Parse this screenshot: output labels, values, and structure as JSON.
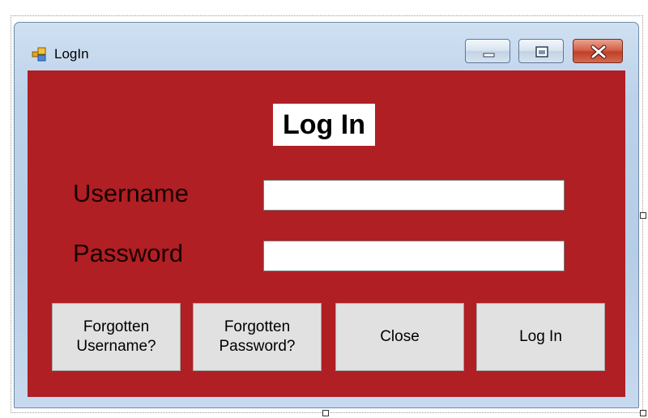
{
  "window": {
    "title": "LogIn",
    "icons": {
      "app": "form-icon",
      "minimize": "minimize-icon",
      "maximize": "maximize-icon",
      "close": "close-icon"
    }
  },
  "form": {
    "heading": "Log In",
    "username_label": "Username",
    "password_label": "Password",
    "username_value": "",
    "password_value": ""
  },
  "buttons": {
    "forgot_username_line1": "Forgotten",
    "forgot_username_line2": "Username?",
    "forgot_password_line1": "Forgotten",
    "forgot_password_line2": "Password?",
    "close": "Close",
    "login": "Log In"
  },
  "colors": {
    "client_background": "#b01f23",
    "button_face": "#e1e1e1"
  }
}
